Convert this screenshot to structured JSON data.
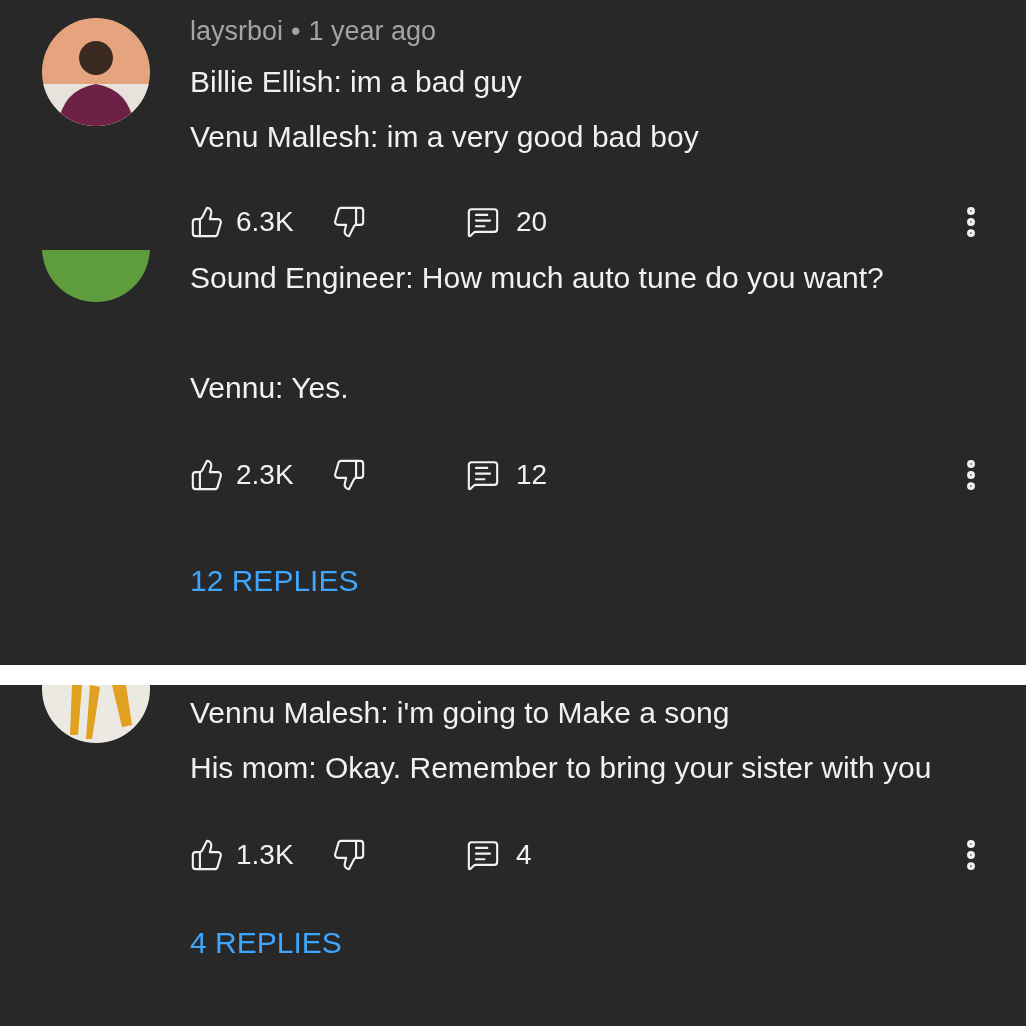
{
  "panels": [
    {
      "avatar": {
        "kind": "person"
      },
      "author": "laysrboi",
      "separator": "•",
      "age": "1 year ago",
      "lines": [
        "Billie Ellish: im a bad guy",
        "Venu Mallesh: im a very good bad boy"
      ],
      "likes": "6.3K",
      "replies_count": "20"
    },
    {
      "avatar": {
        "kind": "green"
      },
      "lines": [
        "Sound Engineer: How much auto tune do you want?",
        "Vennu: Yes."
      ],
      "likes": "2.3K",
      "replies_count": "12",
      "replies_link": "12 REPLIES"
    },
    {
      "avatar": {
        "kind": "figures"
      },
      "lines": [
        "Vennu Malesh: i'm going to Make a song",
        "His mom: Okay. Remember to bring your sister with you"
      ],
      "likes": "1.3K",
      "replies_count": "4",
      "replies_link": "4 REPLIES"
    }
  ]
}
